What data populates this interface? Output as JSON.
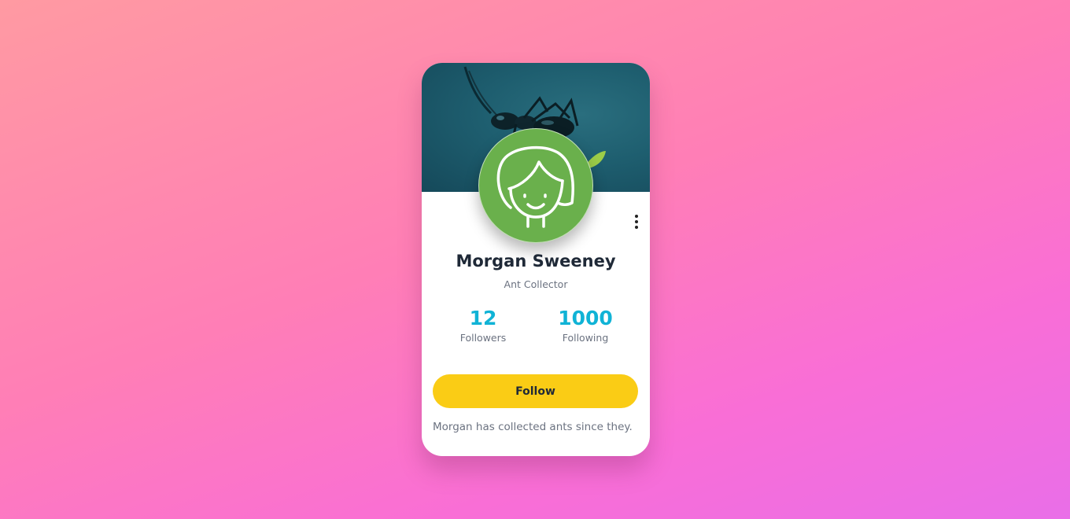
{
  "profile": {
    "name": "Morgan Sweeney",
    "title": "Ant Collector",
    "bio": "Morgan has collected ants since they."
  },
  "stats": {
    "followers": {
      "count": "12",
      "label": "Followers"
    },
    "following": {
      "count": "1000",
      "label": "Following"
    }
  },
  "actions": {
    "follow_label": "Follow"
  },
  "icons": {
    "menu": "more-vertical-icon",
    "avatar": "avatar-illustration"
  },
  "colors": {
    "accent": "#10b3d6",
    "button": "#facc15",
    "avatar_bg": "#6ab04c"
  }
}
